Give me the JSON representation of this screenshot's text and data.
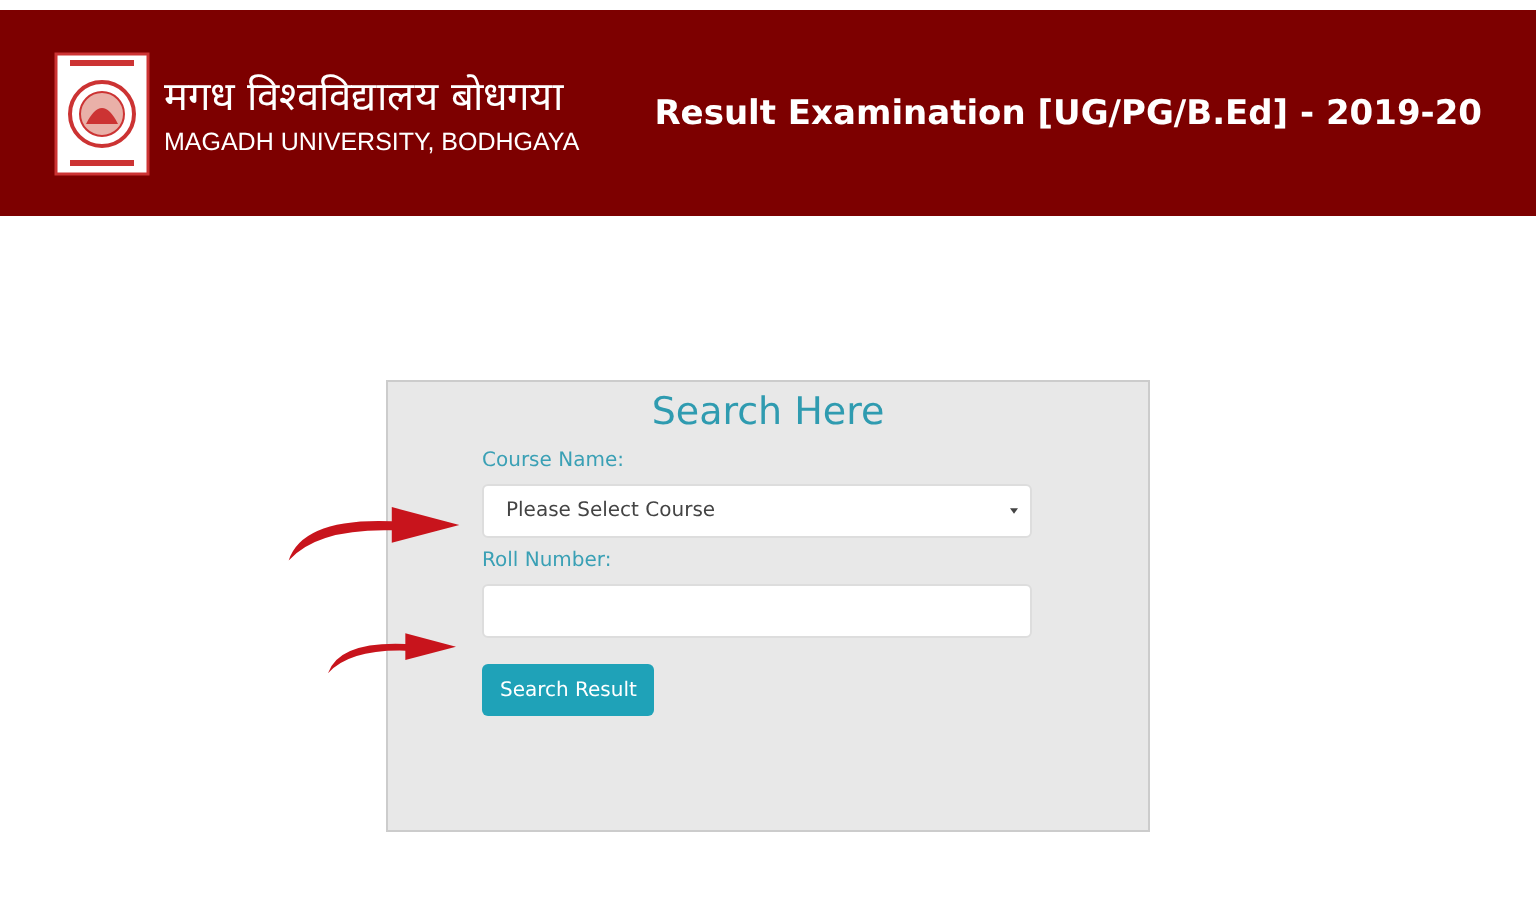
{
  "header": {
    "university_name_hindi": "मगध विश्वविद्यालय बोधगया",
    "university_name": "MAGADH UNIVERSITY, BODHGAYA",
    "title": "Result Examination [UG/PG/B.Ed] - 2019-20"
  },
  "search_form": {
    "title": "Search Here",
    "fields": [
      {
        "kind": "select",
        "label": "Course Name:",
        "value": "Please Select Course"
      },
      {
        "kind": "text",
        "label": "Roll Number:"
      }
    ],
    "button": "Search Result"
  }
}
